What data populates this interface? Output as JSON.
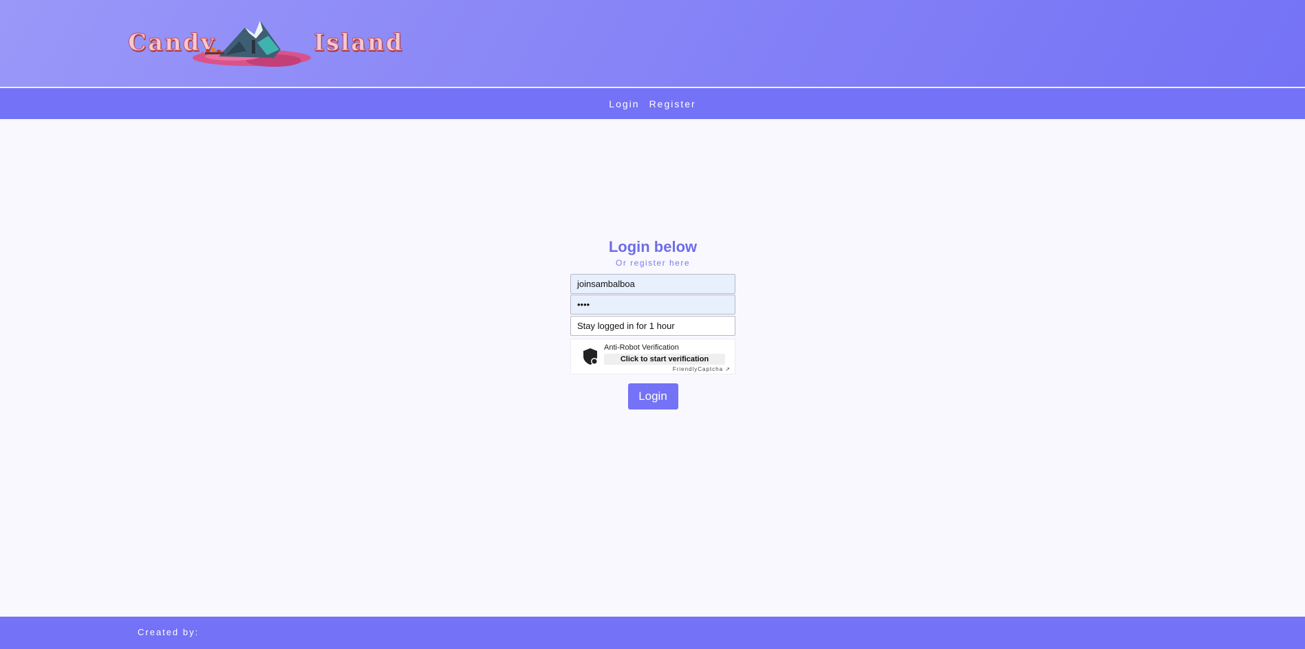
{
  "header": {
    "logo_word_1": "Candy",
    "logo_word_2": "Island"
  },
  "nav": {
    "items": [
      {
        "label": "Login"
      },
      {
        "label": "Register"
      }
    ]
  },
  "login": {
    "title": "Login below",
    "register_link": "Or register here",
    "username_value": "joinsambalboa",
    "password_value": "••••",
    "session_option": "Stay logged in for 1 hour",
    "submit_label": "Login"
  },
  "captcha": {
    "label": "Anti-Robot Verification",
    "button_label": "Click to start verification",
    "brand": "FriendlyCaptcha ↗"
  },
  "footer": {
    "text": "Created by:"
  },
  "colors": {
    "accent": "#7472f6",
    "title": "#6f6ce8",
    "background": "#f8f8fe"
  }
}
